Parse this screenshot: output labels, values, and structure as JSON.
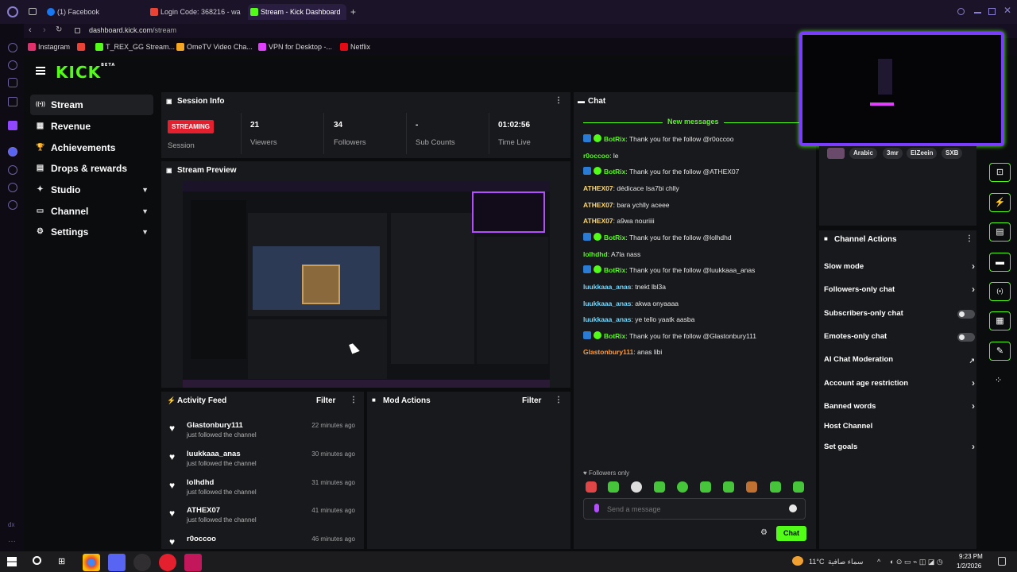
{
  "browser": {
    "tabs": [
      {
        "label": "(1) Facebook",
        "icon_color": "#1877f2"
      },
      {
        "label": "Login Code: 368216 - wa",
        "icon_color": "#ea4335"
      },
      {
        "label": "Stream - Kick Dashboard",
        "icon_color": "#53fc18",
        "active": true
      }
    ],
    "new_tab": "+",
    "address": {
      "host": "dashboard.kick.com",
      "path": "/stream"
    },
    "bookmarks": [
      {
        "label": "Instagram",
        "icon_color": "#e1306c"
      },
      {
        "label": "",
        "icon_color": "#ea4335"
      },
      {
        "label": "T_REX_GG Stream...",
        "icon_color": "#53fc18"
      },
      {
        "label": "OmeTV Video Cha...",
        "icon_color": "#f5a623"
      },
      {
        "label": "VPN for Desktop -...",
        "icon_color": "#e040fb"
      },
      {
        "label": "Netflix",
        "icon_color": "#e50914"
      }
    ]
  },
  "kick": {
    "logo": "KICK",
    "logo_sup": "BETA",
    "nav": [
      {
        "label": "Stream",
        "icon": "broadcast-icon",
        "glyph": "((•))",
        "active": true
      },
      {
        "label": "Revenue",
        "icon": "revenue-icon",
        "glyph": "▦"
      },
      {
        "label": "Achievements",
        "icon": "trophy-icon",
        "glyph": "🏆"
      },
      {
        "label": "Drops & rewards",
        "icon": "drops-icon",
        "glyph": "▤"
      },
      {
        "label": "Studio",
        "icon": "studio-icon",
        "glyph": "✦",
        "expand": true
      },
      {
        "label": "Channel",
        "icon": "channel-icon",
        "glyph": "▭",
        "expand": true
      },
      {
        "label": "Settings",
        "icon": "settings-icon",
        "glyph": "⚙",
        "expand": true
      }
    ],
    "session": {
      "title": "Session Info",
      "status_badge": "STREAMING",
      "status_label": "Session",
      "stats": [
        {
          "value": "21",
          "label": "Viewers"
        },
        {
          "value": "34",
          "label": "Followers"
        },
        {
          "value": "-",
          "label": "Sub Counts"
        },
        {
          "value": "01:02:56",
          "label": "Time Live"
        }
      ]
    },
    "preview": {
      "title": "Stream Preview"
    },
    "activity": {
      "title": "Activity Feed",
      "filter": "Filter",
      "items": [
        {
          "name": "Glastonbury111",
          "sub": "just followed the channel",
          "time": "22 minutes ago"
        },
        {
          "name": "luukkaaa_anas",
          "sub": "just followed the channel",
          "time": "30 minutes ago"
        },
        {
          "name": "lolhdhd",
          "sub": "just followed the channel",
          "time": "31 minutes ago"
        },
        {
          "name": "ATHEX07",
          "sub": "just followed the channel",
          "time": "41 minutes ago"
        },
        {
          "name": "r0occoo",
          "sub": "",
          "time": "46 minutes ago"
        }
      ]
    },
    "mod": {
      "title": "Mod Actions",
      "filter": "Filter"
    },
    "chat": {
      "title": "Chat",
      "new_messages": "New messages",
      "messages": [
        {
          "user": "BotRix",
          "text": "Thank you for the follow @r0occoo",
          "color": "#53fc18",
          "bot": true
        },
        {
          "user": "r0occoo",
          "text": "le",
          "color": "#53fc18"
        },
        {
          "user": "BotRix",
          "text": "Thank you for the follow @ATHEX07",
          "color": "#53fc18",
          "bot": true
        },
        {
          "user": "ATHEX07",
          "text": "dédicace Isa7bi chlly",
          "color": "#ffd76b"
        },
        {
          "user": "ATHEX07",
          "text": "bara ychlly aceee",
          "color": "#ffd76b"
        },
        {
          "user": "ATHEX07",
          "text": "a9wa nouriiii",
          "color": "#ffd76b"
        },
        {
          "user": "BotRix",
          "text": "Thank you for the follow @lolhdhd",
          "color": "#53fc18",
          "bot": true
        },
        {
          "user": "lolhdhd",
          "text": "A7la nass",
          "color": "#53fc18"
        },
        {
          "user": "BotRix",
          "text": "Thank you for the follow @luukkaaa_anas",
          "color": "#53fc18",
          "bot": true
        },
        {
          "user": "luukkaaa_anas",
          "text": "tnekt lbl3a",
          "color": "#72d8ff"
        },
        {
          "user": "luukkaaa_anas",
          "text": "akwa onyaaaa",
          "color": "#72d8ff"
        },
        {
          "user": "luukkaaa_anas",
          "text": "ye tello yaatk aasba",
          "color": "#72d8ff"
        },
        {
          "user": "BotRix",
          "text": "Thank you for the follow @Glastonbury111",
          "color": "#53fc18",
          "bot": true
        },
        {
          "user": "Glastonbury111",
          "text": "anas libi",
          "color": "#ff9a3c"
        }
      ],
      "followers_only": "Followers only",
      "input_placeholder": "Send a message",
      "send": "Chat"
    },
    "tags": [
      "Arabic",
      "3mr",
      "ElZeein",
      "SXB"
    ],
    "actions": {
      "title": "Channel Actions",
      "items": [
        {
          "label": "Slow mode",
          "kind": "arrow"
        },
        {
          "label": "Followers-only chat",
          "kind": "arrow"
        },
        {
          "label": "Subscribers-only chat",
          "kind": "toggle"
        },
        {
          "label": "Emotes-only chat",
          "kind": "toggle"
        },
        {
          "label": "AI Chat Moderation",
          "kind": "external"
        },
        {
          "label": "Account age restriction",
          "kind": "arrow"
        },
        {
          "label": "Banned words",
          "kind": "arrow"
        },
        {
          "label": "Host Channel",
          "kind": "none"
        },
        {
          "label": "Set goals",
          "kind": "arrow"
        }
      ]
    }
  },
  "taskbar": {
    "weather": "11°C",
    "weather_text": "سماء صافية",
    "time": "9:23 PM",
    "date": "1/2/2026"
  }
}
